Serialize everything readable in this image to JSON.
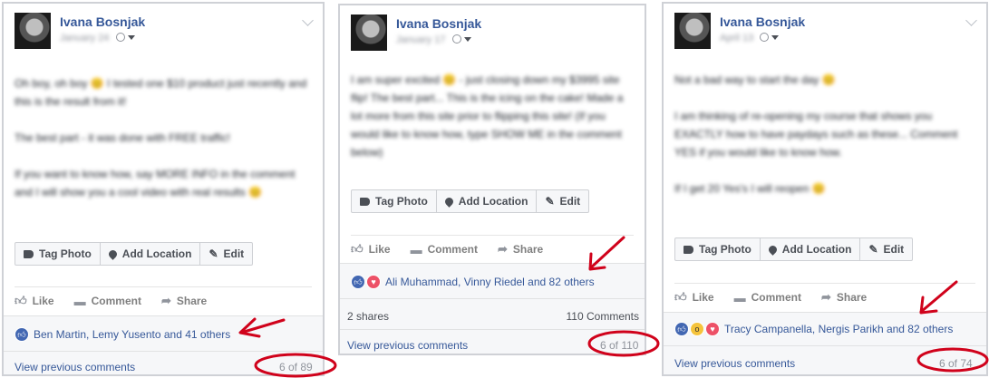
{
  "posts": [
    {
      "author": "Ivana Bosnjak",
      "date": "January 24",
      "body": [
        "Oh boy, oh boy 😊 I tested one $10 product just recently and this is the result from it!",
        "The best part - it was done with FREE traffic!",
        "If you want to know how, say MORE INFO in the comment and I will show you a cool video with real results 😊"
      ],
      "tag_photo": "Tag Photo",
      "add_location": "Add Location",
      "edit": "Edit",
      "like": "Like",
      "comment": "Comment",
      "share": "Share",
      "reactions_text": "Ben Martin, Lemy Yusento and 41 others",
      "view_previous": "View previous comments",
      "counter": "6 of 89"
    },
    {
      "author": "Ivana Bosnjak",
      "date": "January 17",
      "body": [
        "I am super excited 😊 - just closing down my $3995 site flip! The best part... This is the icing on the cake! Made a lot more from this site prior to flipping this site! (If you would like to know how, type SHOW ME in the comment below)"
      ],
      "tag_photo": "Tag Photo",
      "add_location": "Add Location",
      "edit": "Edit",
      "like": "Like",
      "comment": "Comment",
      "share": "Share",
      "reactions_text": "Ali Muhammad, Vinny Riedel and 82 others",
      "shares": "2 shares",
      "comments_count": "110 Comments",
      "view_previous": "View previous comments",
      "counter": "6 of 110"
    },
    {
      "author": "Ivana Bosnjak",
      "date": "April 13",
      "body": [
        "Not a bad way to start the day 😊",
        "I am thinking of re-opening my course that shows you EXACTLY how to have paydays such as these... Comment YES if you would like to know how.",
        "If I get 20 Yes's I will reopen 😊"
      ],
      "tag_photo": "Tag Photo",
      "add_location": "Add Location",
      "edit": "Edit",
      "like": "Like",
      "comment": "Comment",
      "share": "Share",
      "reactions_text": "Tracy Campanella, Nergis Parikh and 82 others",
      "view_previous": "View previous comments",
      "counter": "6 of 74"
    }
  ],
  "annotation_color": "#d0021b",
  "brand_color": "#365899"
}
